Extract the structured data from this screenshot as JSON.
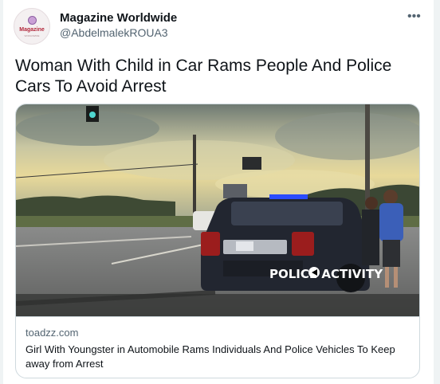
{
  "author": {
    "avatar_brand": "Magazine",
    "avatar_sub": "WORLDWIDE",
    "display_name": "Magazine Worldwide",
    "handle": "@AbdelmalekROUA3",
    "more_icon": "more-horizontal-icon"
  },
  "tweet": {
    "text": "Woman With Child in Car Rams People And Police Cars To Avoid Arrest"
  },
  "card": {
    "image_overlay": "POLICE ACTIVITY",
    "domain": "toadzz.com",
    "title": "Girl With Youngster in Automobile Rams Individuals And Police Vehicles To Keep away from Arrest"
  },
  "colors": {
    "text_primary": "#0f1419",
    "text_secondary": "#536471",
    "border": "#cfd9de"
  }
}
